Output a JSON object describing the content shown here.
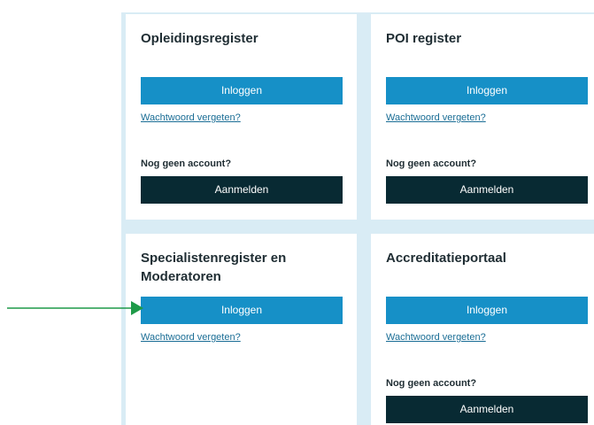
{
  "cards": [
    {
      "title": "Opleidingsregister",
      "login_label": "Inloggen",
      "forgot_label": "Wachtwoord vergeten?",
      "no_account_label": "Nog geen account?",
      "signup_label": "Aanmelden"
    },
    {
      "title": "POI register",
      "login_label": "Inloggen",
      "forgot_label": "Wachtwoord vergeten?",
      "no_account_label": "Nog geen account?",
      "signup_label": "Aanmelden"
    },
    {
      "title_line1": "Specialistenregister en",
      "title_line2": "Moderatoren",
      "login_label": "Inloggen",
      "forgot_label": "Wachtwoord vergeten?"
    },
    {
      "title": "Accreditatieportaal",
      "login_label": "Inloggen",
      "forgot_label": "Wachtwoord vergeten?",
      "no_account_label": "Nog geen account?",
      "signup_label": "Aanmelden"
    }
  ],
  "colors": {
    "panel_background": "#d9ecf5",
    "login_button": "#1690c7",
    "signup_button": "#082a33",
    "link": "#1a6d95",
    "annotation_arrow": "#1e9a48"
  },
  "annotation": {
    "icon": "arrow-right-icon"
  }
}
